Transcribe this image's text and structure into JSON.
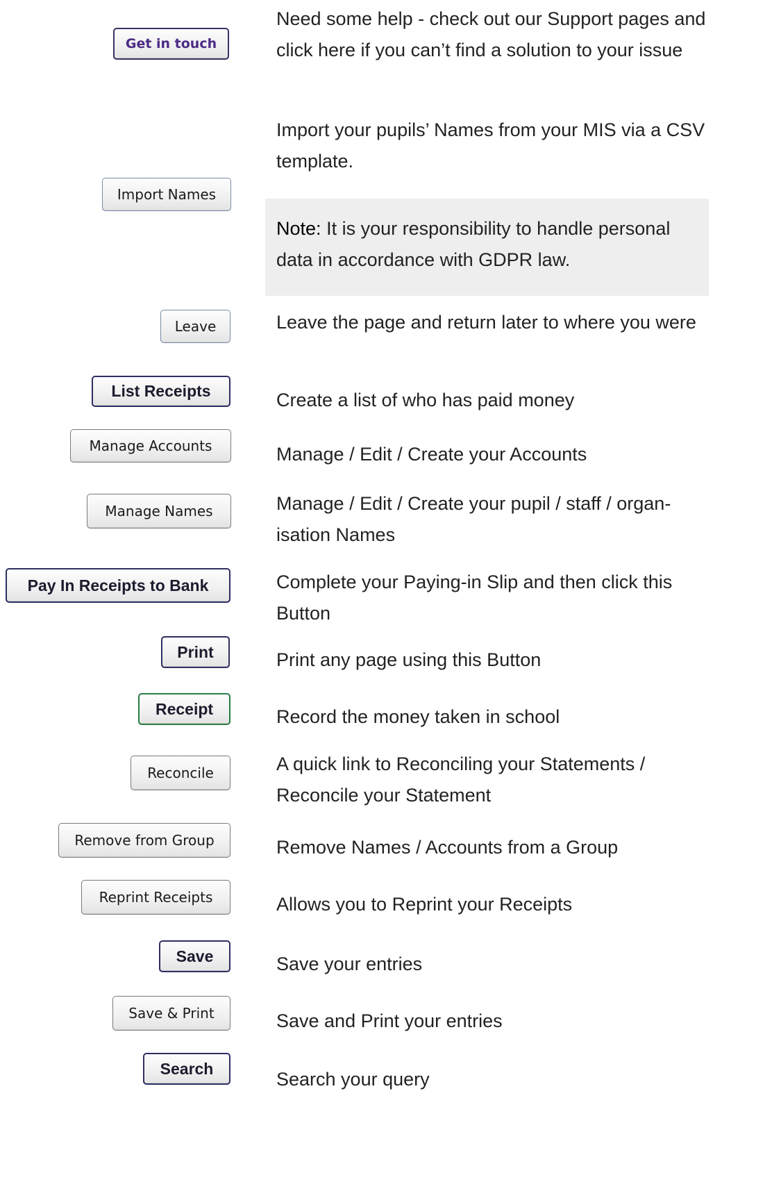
{
  "rows": [
    {
      "button_label": "Get in touch",
      "description": "Need some help - check out our Support pages and click here if you can’t find a solution to your issue"
    },
    {
      "button_label": "Import Names",
      "description": "Import your pupils’ Names from your MIS via a CSV template."
    },
    {
      "button_label": "Leave",
      "description": "Leave the page and return later to where you were"
    },
    {
      "button_label": "List Receipts",
      "description": "Create a list of who has paid money"
    },
    {
      "button_label": "Manage Accounts",
      "description": "Manage / Edit / Create your Accounts"
    },
    {
      "button_label": "Manage Names",
      "description": "Manage / Edit / Create your pupil / staff / organ­isation Names"
    },
    {
      "button_label": "Pay In Receipts to Bank",
      "description": "Complete your Paying-in Slip and then click this Button"
    },
    {
      "button_label": "Print",
      "description": "Print any page using this Button"
    },
    {
      "button_label": "Receipt",
      "description": "Record the money taken in school"
    },
    {
      "button_label": "Reconcile",
      "description": "A quick link to Reconciling your Statements / Reconcile your Statement"
    },
    {
      "button_label": "Remove from Group",
      "description": "Remove Names / Accounts from a Group"
    },
    {
      "button_label": "Reprint Receipts",
      "description": "Allows you to Reprint your Receipts"
    },
    {
      "button_label": "Save",
      "description": "Save your entries"
    },
    {
      "button_label": "Save & Print",
      "description": "Save and Print your entries"
    },
    {
      "button_label": "Search",
      "description": "Search your query"
    }
  ],
  "note": {
    "label": "Note:",
    "text": "It is your responsibility to handle personal data in accordance with GDPR law."
  }
}
